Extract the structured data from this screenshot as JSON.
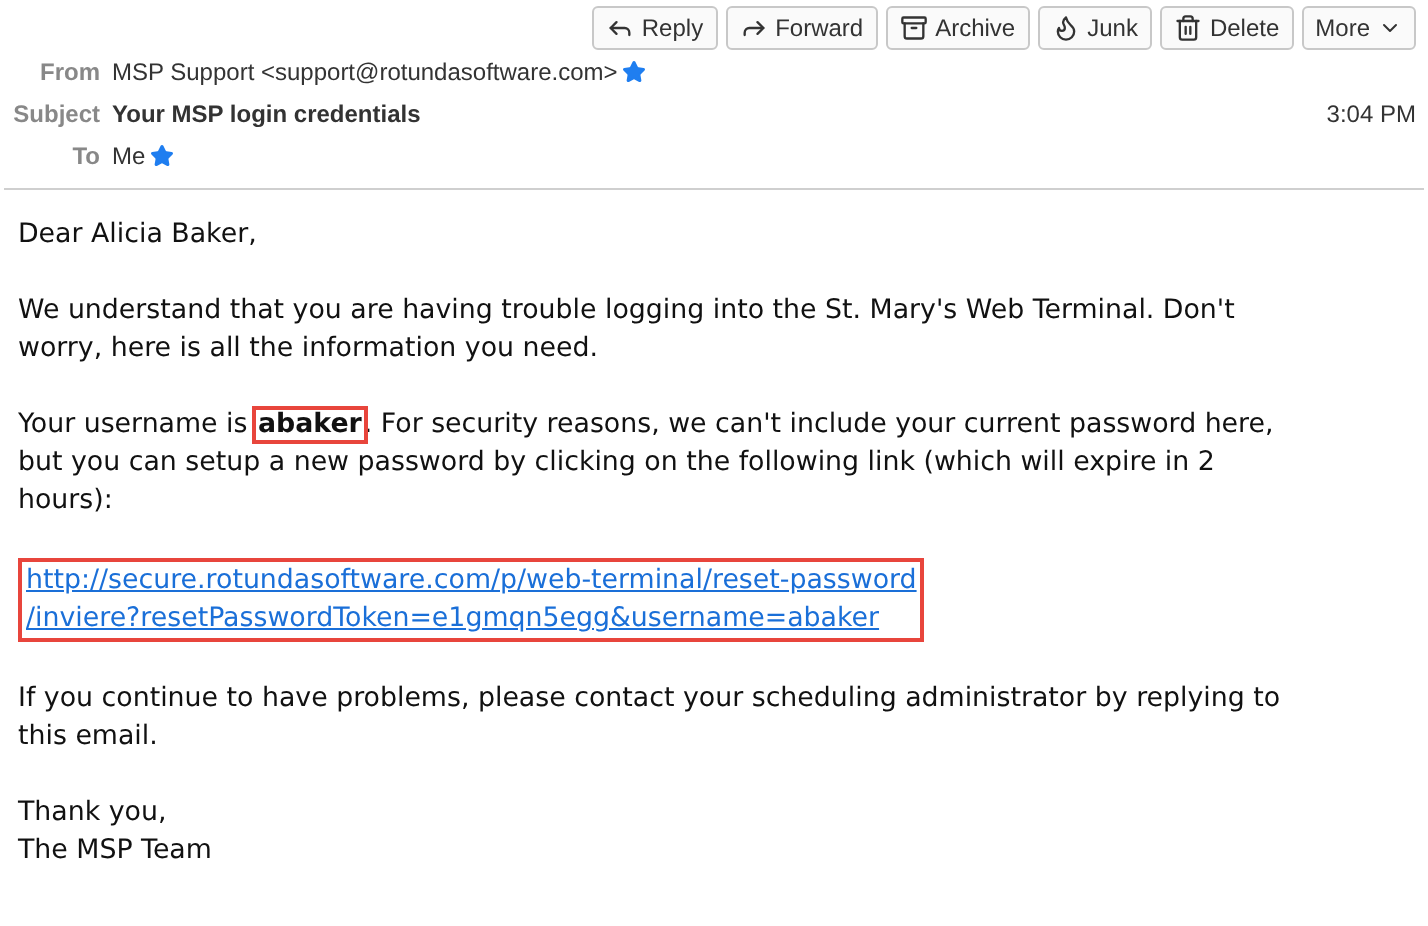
{
  "toolbar": [
    {
      "kind": "reply",
      "label": "Reply"
    },
    {
      "kind": "forward",
      "label": "Forward"
    },
    {
      "kind": "archive",
      "label": "Archive"
    },
    {
      "kind": "junk",
      "label": "Junk"
    },
    {
      "kind": "delete",
      "label": "Delete"
    },
    {
      "kind": "more",
      "label": "More"
    }
  ],
  "header": {
    "from": {
      "label": "From",
      "value": "MSP Support <support@rotundasoftware.com>",
      "starred": true
    },
    "subject": {
      "label": "Subject",
      "value": "Your MSP login credentials"
    },
    "time": "3:04 PM",
    "to": {
      "label": "To",
      "value": "Me",
      "starred": true
    }
  },
  "body": [
    {
      "kind": "text",
      "lines": [
        [
          {
            "text": "Dear Alicia Baker,",
            "highlighted": false
          }
        ]
      ]
    },
    {
      "kind": "text",
      "lines": [
        [
          {
            "text": "We understand that you are having trouble logging into the St. Mary's Web Terminal. Don't",
            "highlighted": false
          }
        ],
        [
          {
            "text": "worry, here is all the information you need.",
            "highlighted": false
          }
        ]
      ]
    },
    {
      "kind": "text",
      "lines": [
        [
          {
            "text": "Your username is ",
            "highlighted": false
          },
          {
            "text": "abaker",
            "highlighted": true
          },
          {
            "text": ". For security reasons, we can't include your current password here,",
            "highlighted": false
          }
        ],
        [
          {
            "text": "but you can setup a new password by clicking on the following link (which will expire in 2",
            "highlighted": false
          }
        ],
        [
          {
            "text": "hours):",
            "highlighted": false
          }
        ]
      ]
    },
    {
      "kind": "link",
      "highlighted": true,
      "lines": [
        "http://secure.rotundasoftware.com/p/web-terminal/reset-password",
        "/inviere?resetPasswordToken=e1gmqn5egg&username=abaker"
      ]
    },
    {
      "kind": "text",
      "lines": [
        [
          {
            "text": "If you continue to have problems, please contact your scheduling administrator by replying to",
            "highlighted": false
          }
        ],
        [
          {
            "text": "this email.",
            "highlighted": false
          }
        ]
      ]
    },
    {
      "kind": "text",
      "lines": [
        [
          {
            "text": "Thank you,",
            "highlighted": false
          }
        ],
        [
          {
            "text": "The MSP Team",
            "highlighted": false
          }
        ]
      ]
    }
  ]
}
